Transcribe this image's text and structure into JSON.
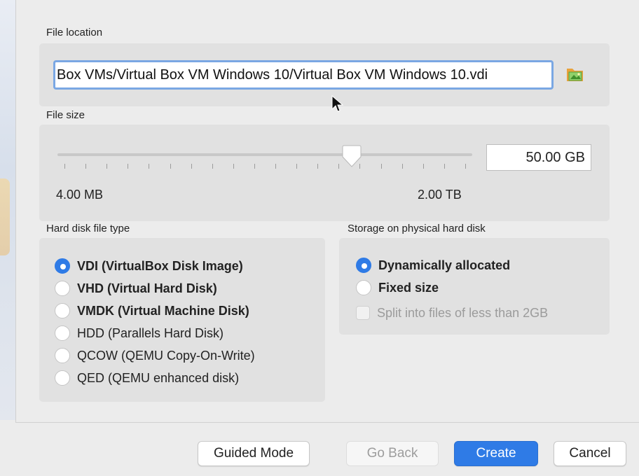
{
  "file_location": {
    "label": "File location",
    "path_value": "Box VMs/Virtual Box VM Windows 10/Virtual Box VM Windows 10.vdi",
    "folder_icon": "folder-image-icon"
  },
  "file_size": {
    "label": "File size",
    "value": "50.00 GB",
    "min_label": "4.00 MB",
    "max_label": "2.00 TB",
    "slider_fraction": 0.71
  },
  "hard_disk_type": {
    "label": "Hard disk file type",
    "options": [
      {
        "label": "VDI (VirtualBox Disk Image)",
        "selected": true,
        "bold": true
      },
      {
        "label": "VHD (Virtual Hard Disk)",
        "selected": false,
        "bold": true
      },
      {
        "label": "VMDK (Virtual Machine Disk)",
        "selected": false,
        "bold": true
      },
      {
        "label": "HDD (Parallels Hard Disk)",
        "selected": false,
        "bold": false
      },
      {
        "label": "QCOW (QEMU Copy-On-Write)",
        "selected": false,
        "bold": false
      },
      {
        "label": "QED (QEMU enhanced disk)",
        "selected": false,
        "bold": false
      }
    ]
  },
  "storage": {
    "label": "Storage on physical hard disk",
    "options": [
      {
        "label": "Dynamically allocated",
        "selected": true
      },
      {
        "label": "Fixed size",
        "selected": false
      }
    ],
    "split_label": "Split into files of less than 2GB",
    "split_checked": false,
    "split_enabled": false
  },
  "buttons": {
    "guided_mode": "Guided Mode",
    "go_back": "Go Back",
    "create": "Create",
    "cancel": "Cancel"
  },
  "colors": {
    "accent": "#2f7be6",
    "focus_ring": "#7aa7e3"
  }
}
